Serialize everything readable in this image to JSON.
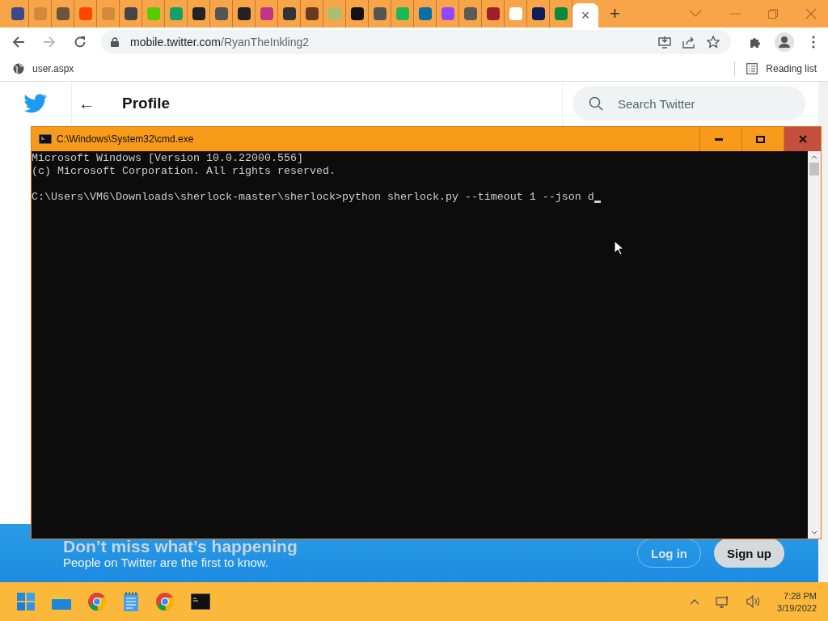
{
  "browser": {
    "tabs": [
      {
        "selected": false
      },
      {
        "selected": false
      },
      {
        "selected": false
      },
      {
        "selected": false
      },
      {
        "selected": false
      },
      {
        "selected": false
      },
      {
        "selected": false
      },
      {
        "selected": false
      },
      {
        "selected": false
      },
      {
        "selected": false
      },
      {
        "selected": false
      },
      {
        "selected": false
      },
      {
        "selected": false
      },
      {
        "selected": false
      },
      {
        "selected": false
      },
      {
        "selected": false
      },
      {
        "selected": false
      },
      {
        "selected": false
      },
      {
        "selected": false
      },
      {
        "selected": false
      },
      {
        "selected": false
      },
      {
        "selected": false
      },
      {
        "selected": false
      },
      {
        "selected": false
      },
      {
        "selected": false
      },
      {
        "selected": true
      }
    ],
    "tab_close": "×",
    "new_tab": "+",
    "address": {
      "host": "mobile.twitter.com",
      "path": "/RyanTheInkling2"
    },
    "bookmark": "user.aspx",
    "reading_list": "Reading list"
  },
  "page": {
    "header": {
      "back": "←",
      "title": "Profile"
    },
    "search": {
      "placeholder": "Search Twitter"
    },
    "banner": {
      "headline": "Don’t miss what’s happening",
      "subline": "People on Twitter are the first to know.",
      "login": "Log in",
      "signup": "Sign up"
    }
  },
  "console": {
    "title": "C:\\Windows\\System32\\cmd.exe",
    "lines": [
      "Microsoft Windows [Version 10.0.22000.556]",
      "(c) Microsoft Corporation. All rights reserved."
    ],
    "prompt": "C:\\Users\\VM6\\Downloads\\sherlock-master\\sherlock>python sherlock.py --timeout 1 --json d"
  },
  "taskbar": {
    "time": "7:28 PM",
    "date": "3/19/2022"
  }
}
